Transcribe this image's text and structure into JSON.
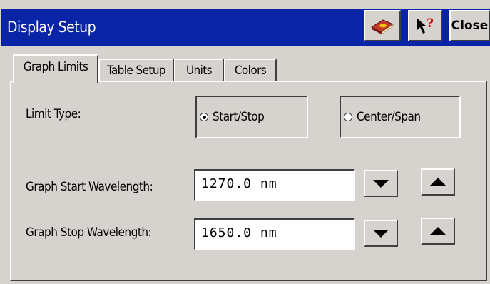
{
  "window": {
    "title": "Display Setup",
    "close_label": "Close",
    "title_bar_color": "#0a24a8",
    "icons": [
      "book-icon",
      "help-pointer-icon"
    ]
  },
  "tabs": [
    {
      "label": "Graph Limits",
      "active": true
    },
    {
      "label": "Table Setup",
      "active": false
    },
    {
      "label": "Units",
      "active": false
    },
    {
      "label": "Colors",
      "active": false
    }
  ],
  "limit_type": {
    "label": "Limit Type:",
    "options": [
      {
        "label": "Start/Stop",
        "selected": true
      },
      {
        "label": "Center/Span",
        "selected": false
      }
    ]
  },
  "start": {
    "label": "Graph Start Wavelength:",
    "value": "1270.0 nm"
  },
  "stop": {
    "label": "Graph Stop Wavelength:",
    "value": "1650.0 nm"
  }
}
